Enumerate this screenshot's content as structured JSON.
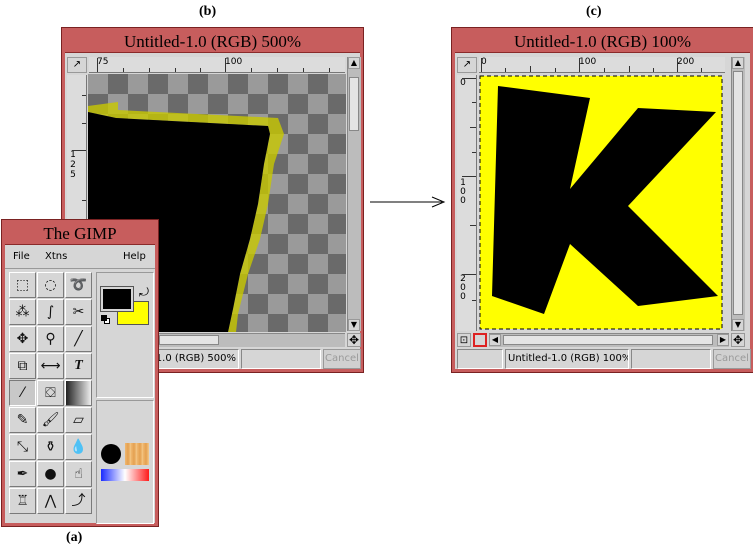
{
  "labels": {
    "a": "(a)",
    "b": "(b)",
    "c": "(c)"
  },
  "window_b": {
    "title": "Untitled-1.0 (RGB) 500%",
    "ruler_h": [
      "75",
      "100"
    ],
    "ruler_v": [
      "1",
      "2",
      "5"
    ],
    "status": "Untitled-1.0 (RGB) 500%",
    "cancel": "Cancel"
  },
  "window_c": {
    "title": "Untitled-1.0 (RGB) 100%",
    "ruler_h": [
      "0",
      "100",
      "200"
    ],
    "ruler_v_0": [
      "0"
    ],
    "ruler_v_100": [
      "1",
      "0",
      "0"
    ],
    "ruler_v_200": [
      "2",
      "0",
      "0"
    ],
    "status": "Untitled-1.0 (RGB) 100%",
    "cancel": "Cancel"
  },
  "toolbox": {
    "title": "The GIMP",
    "menu": {
      "file": "File",
      "xtns": "Xtns",
      "help": "Help"
    },
    "tools": [
      "rect-select",
      "ellipse-select",
      "lasso-select",
      "magic-wand",
      "bezier-select",
      "scissors-select",
      "move",
      "magnify",
      "crop",
      "transform",
      "flip",
      "text",
      "color-picker",
      "bucket-fill",
      "blend",
      "pencil",
      "paintbrush",
      "eraser",
      "airbrush",
      "clone",
      "convolve",
      "ink",
      "dodge-burn",
      "smudge",
      "measure",
      "path",
      "iscissors"
    ],
    "active_tool": "color-picker",
    "fg_color": "#000000",
    "bg_color": "#ffff00",
    "brush_color": "#000000",
    "pattern_color": "#e8a95c"
  },
  "colors": {
    "title_bar": "#c75d5d",
    "image_yellow": "#ffff00",
    "image_black": "#000000"
  }
}
